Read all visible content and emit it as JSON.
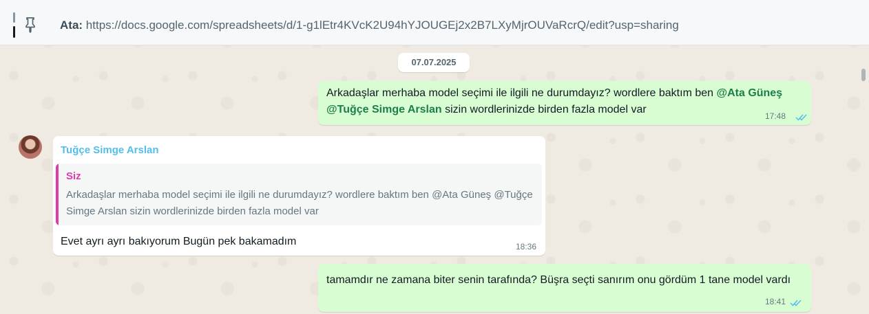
{
  "pinned": {
    "sender": "Ata:",
    "text": "https://docs.google.com/spreadsheets/d/1-g1lEtr4KVcK2U94hYJOUGEj2x2B7LXyMjrOUVaRcrQ/edit?usp=sharing"
  },
  "date_separator": "07.07.2025",
  "messages": [
    {
      "direction": "out",
      "text_before": "Arkadaşlar merhaba model seçimi ile ilgili ne durumdayız? wordlere baktım ben ",
      "mention1": "@Ata Güneş",
      "mention2": "@Tuğçe Simge Arslan",
      "text_after": " sizin wordlerinizde birden fazla model var",
      "time": "17:48"
    },
    {
      "direction": "in",
      "sender": "Tuğçe Simge Arslan",
      "quote_author": "Siz",
      "quote_text": "Arkadaşlar merhaba model seçimi ile ilgili ne durumdayız? wordlere baktım ben @Ata Güneş @Tuğçe Simge Arslan sizin wordlerinizde birden fazla model var",
      "text": "Evet ayrı ayrı bakıyorum Bugün pek bakamadım",
      "time": "18:36"
    },
    {
      "direction": "out",
      "text": "tamamdır ne zamana biter senin tarafında? Büşra seçti sanırım onu gördüm 1 tane model vardı",
      "time": "18:41"
    }
  ],
  "colors": {
    "outgoing_bubble": "#d9fdd3",
    "incoming_bubble": "#ffffff",
    "read_ticks": "#53bdeb",
    "sender_name": "#53bdeb",
    "quote_accent": "#df3bad"
  },
  "icons": {
    "pin": "pin-icon",
    "read_receipt": "double-check-icon"
  }
}
